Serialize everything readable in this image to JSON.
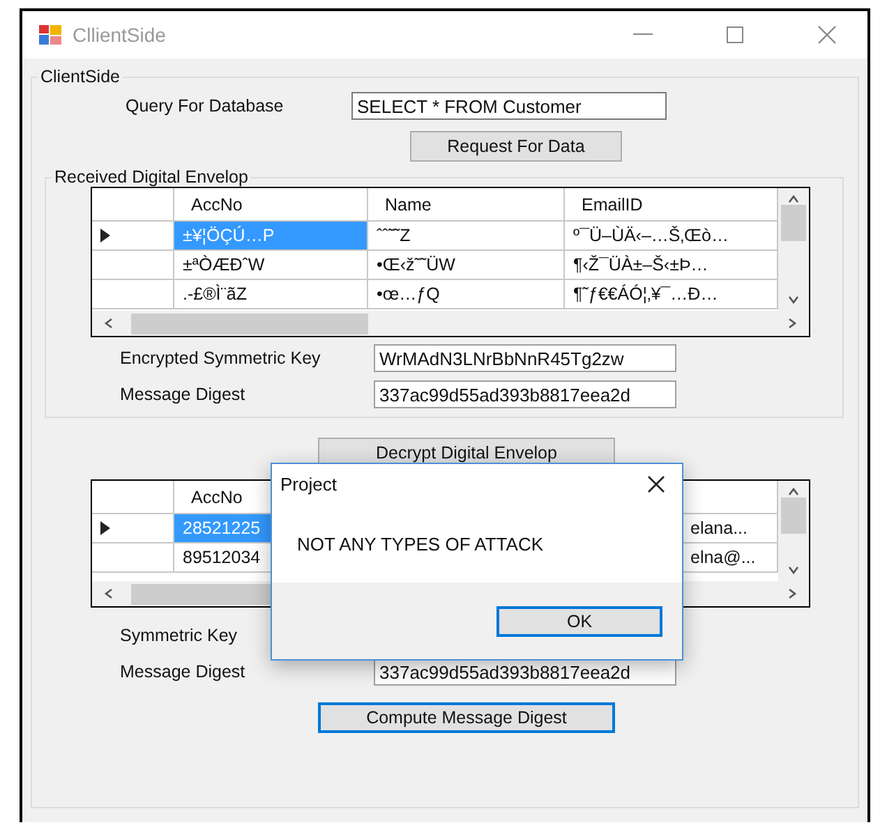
{
  "window": {
    "title": "CllientSide"
  },
  "group": {
    "title": "ClientSide"
  },
  "query": {
    "label": "Query For Database",
    "value": "SELECT * FROM Customer"
  },
  "request_button": "Request For Data",
  "envelope": {
    "title": "Received Digital Envelop",
    "grid": {
      "columns": [
        "AccNo",
        "Name",
        "EmailID"
      ],
      "rows": [
        {
          "selected": true,
          "cells": [
            "±¥¦ÖÇÚ…P",
            "ˆˆ˜˜Z",
            "º¯Ü–ÙÄ‹–…Š‚Œò…"
          ]
        },
        {
          "selected": false,
          "cells": [
            "±ªÒÆÐˆW",
            "•Œ‹ž˜˜ÜW",
            "¶‹Ž¯ÜÀ±–Š‹±Þ…"
          ]
        },
        {
          "selected": false,
          "cells": [
            ".-£®Ì¨ãZ",
            "•œ…ƒQ",
            "¶˜ƒ€€ÁÓ¦‚¥¯…Ð…"
          ]
        }
      ]
    },
    "fields": [
      {
        "label": "Encrypted Symmetric Key",
        "value": "WrMAdN3LNrBbNnR45Tg2zw"
      },
      {
        "label": "Message Digest",
        "value": "337ac99d55ad393b8817eea2d"
      }
    ]
  },
  "decrypt_button": "Decrypt Digital Envelop",
  "decrypted": {
    "grid": {
      "columns": [
        "AccNo"
      ],
      "rows": [
        {
          "selected": true,
          "cells": [
            "28521225",
            "",
            "elana..."
          ]
        },
        {
          "selected": false,
          "cells": [
            "89512034",
            "",
            "elna@..."
          ]
        }
      ]
    },
    "fields": [
      {
        "label": "Symmetric Key"
      },
      {
        "label": "Message Digest",
        "value": "337ac99d55ad393b8817eea2d"
      }
    ]
  },
  "compute_button": "Compute Message Digest",
  "dialog": {
    "title": "Project",
    "message": "NOT ANY TYPES OF ATTACK",
    "buttons": [
      "OK"
    ]
  }
}
